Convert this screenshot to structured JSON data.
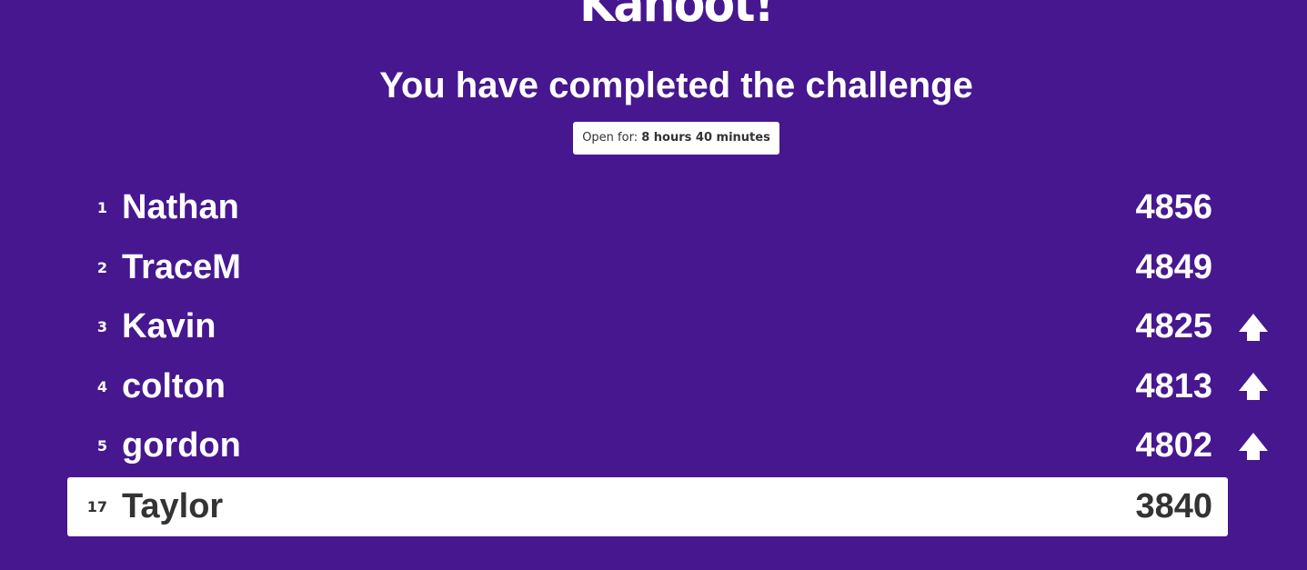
{
  "logo_text": "Kahoot!",
  "headline": "You have completed the challenge",
  "open_for": {
    "label": "Open for:",
    "value": "8 hours 40 minutes"
  },
  "leaderboard": [
    {
      "rank": "1",
      "name": "Nathan",
      "score": "4856",
      "trend": ""
    },
    {
      "rank": "2",
      "name": "TraceM",
      "score": "4849",
      "trend": ""
    },
    {
      "rank": "3",
      "name": "Kavin",
      "score": "4825",
      "trend": "up-arrow-icon"
    },
    {
      "rank": "4",
      "name": "colton",
      "score": "4813",
      "trend": "up-arrow-icon"
    },
    {
      "rank": "5",
      "name": "gordon",
      "score": "4802",
      "trend": "up-arrow-icon"
    }
  ],
  "current_player": {
    "rank": "17",
    "name": "Taylor",
    "score": "3840"
  },
  "colors": {
    "background": "#46178f",
    "highlight_row": "#ffffff",
    "highlight_text": "#333333"
  }
}
